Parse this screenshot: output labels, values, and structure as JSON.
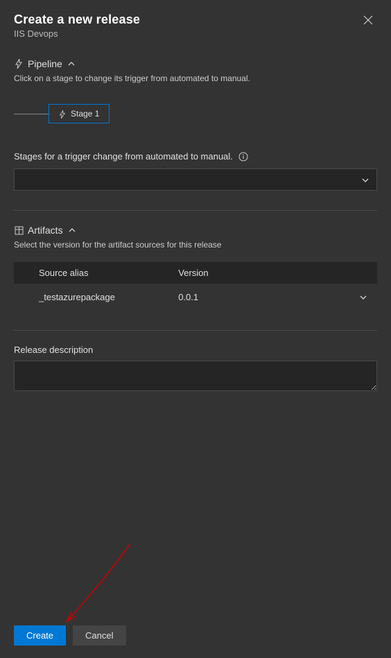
{
  "header": {
    "title": "Create a new release",
    "subtitle": "IIS Devops"
  },
  "pipeline": {
    "section_label": "Pipeline",
    "description": "Click on a stage to change its trigger from automated to manual.",
    "stage_label": "Stage 1"
  },
  "trigger": {
    "label": "Stages for a trigger change from automated to manual.",
    "selected": ""
  },
  "artifacts": {
    "section_label": "Artifacts",
    "description": "Select the version for the artifact sources for this release",
    "columns": {
      "source": "Source alias",
      "version": "Version"
    },
    "rows": [
      {
        "source": "_testazurepackage",
        "version": "0.0.1"
      }
    ]
  },
  "release_description": {
    "label": "Release description",
    "value": ""
  },
  "footer": {
    "create": "Create",
    "cancel": "Cancel"
  }
}
